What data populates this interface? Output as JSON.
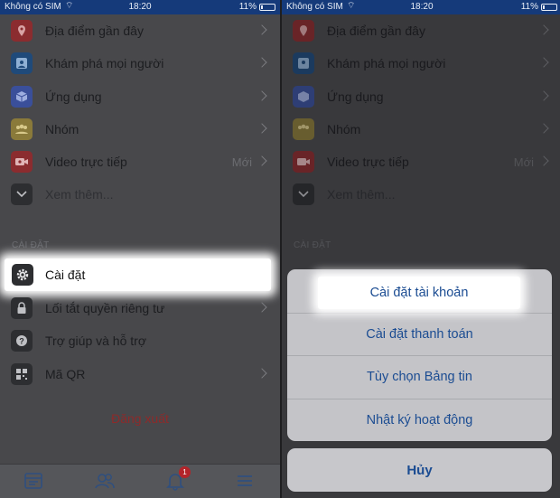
{
  "status": {
    "carrier": "Không có SIM",
    "time": "18:20",
    "battery": "11%"
  },
  "menu": [
    {
      "label": "Địa điểm gần đây",
      "icon": "location-pin-icon",
      "color": "#8b2c2f"
    },
    {
      "label": "Khám phá mọi người",
      "icon": "people-discover-icon",
      "color": "#1f4a7a"
    },
    {
      "label": "Ứng dụng",
      "icon": "cube-app-icon",
      "color": "#3a4f9a"
    },
    {
      "label": "Nhóm",
      "icon": "group-icon",
      "color": "#8a7a3a"
    },
    {
      "label": "Video trực tiếp",
      "icon": "live-video-icon",
      "color": "#8b2c2f",
      "badge": "Mới"
    },
    {
      "label": "Xem thêm...",
      "icon": "chevron-down-icon",
      "color": "#2d2e31"
    }
  ],
  "settings": {
    "header": "CÀI ĐẶT",
    "items": [
      {
        "label": "Cài đặt",
        "icon": "gear-icon"
      },
      {
        "label": "Lối tắt quyền riêng tư",
        "icon": "lock-icon"
      },
      {
        "label": "Trợ giúp và hỗ trợ",
        "icon": "help-icon"
      },
      {
        "label": "Mã QR",
        "icon": "qr-code-icon"
      }
    ]
  },
  "logout": "Đăng xuất",
  "tabbar": {
    "notification_count": "1"
  },
  "action_sheet": {
    "options": [
      "Cài đặt tài khoản",
      "Cài đặt thanh toán",
      "Tùy chọn Bảng tin",
      "Nhật ký hoạt động"
    ],
    "cancel": "Hủy"
  }
}
